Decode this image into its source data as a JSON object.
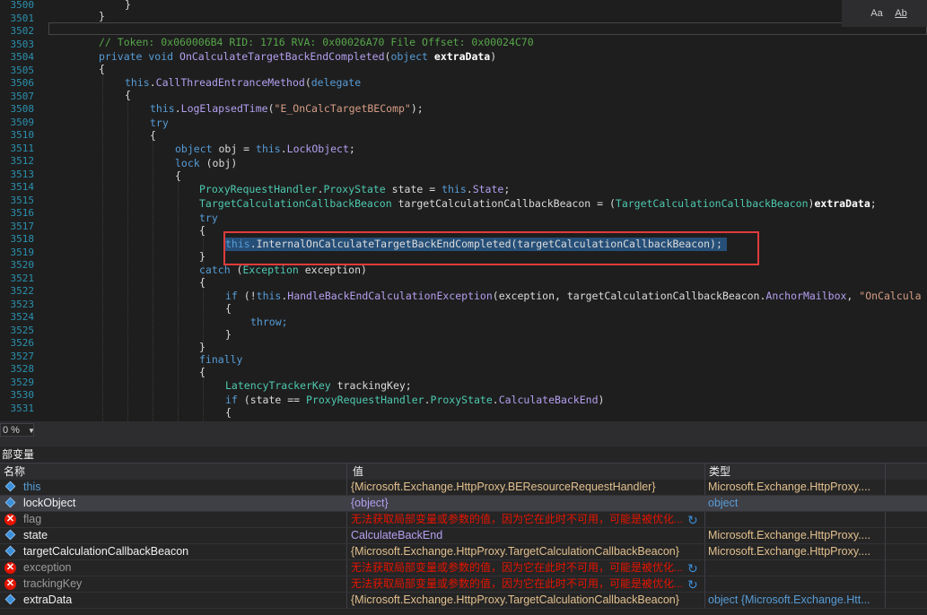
{
  "editor": {
    "line_numbers": [
      "3500",
      "3501",
      "3502",
      "3503",
      "3504",
      "3505",
      "3506",
      "3507",
      "3508",
      "3509",
      "3510",
      "3511",
      "3512",
      "3513",
      "3514",
      "3515",
      "3516",
      "3517",
      "3518",
      "3519",
      "3520",
      "3521",
      "3522",
      "3523",
      "3524",
      "3525",
      "3526",
      "3527",
      "3528",
      "3529",
      "3530",
      "3531"
    ],
    "lines": {
      "l3500": "}",
      "l3501": "}",
      "l3503": "// Token: 0x060006B4 RID: 1716 RVA: 0x00026A70 File Offset: 0x00024C70",
      "l3504_kw": "private void ",
      "l3504_name": "OnCalculateTargetBackEndCompleted",
      "l3504_p1": "(",
      "l3504_kw2": "object ",
      "l3504_arg": "extraData",
      "l3504_p2": ")",
      "l3505": "{",
      "l3506_this": "this",
      "l3506_dot": ".",
      "l3506_m": "CallThreadEntranceMethod",
      "l3506_p": "(",
      "l3506_kw": "delegate",
      "l3507": "{",
      "l3508_this": "this",
      "l3508_dot": ".",
      "l3508_m": "LogElapsedTime",
      "l3508_p": "(",
      "l3508_s": "\"E_OnCalcTargetBEComp\"",
      "l3508_e": ");",
      "l3509": "try",
      "l3510": "{",
      "l3511_kw": "object ",
      "l3511_a": "obj = ",
      "l3511_this": "this",
      "l3511_dot": ".",
      "l3511_m": "LockObject",
      "l3511_e": ";",
      "l3512_kw": "lock ",
      "l3512_a": "(obj)",
      "l3513": "{",
      "l3514_t": "ProxyRequestHandler",
      "l3514_dot": ".",
      "l3514_t2": "ProxyState",
      "l3514_a": " state = ",
      "l3514_this": "this",
      "l3514_dot2": ".",
      "l3514_m": "State",
      "l3514_e": ";",
      "l3515_t": "TargetCalculationCallbackBeacon",
      "l3515_a": " targetCalculationCallbackBeacon = (",
      "l3515_t2": "TargetCalculationCallbackBeacon",
      "l3515_p": ")",
      "l3515_b": "extraData",
      "l3515_e": ";",
      "l3516": "try",
      "l3517": "{",
      "l3518_this": "this",
      "l3518_rest": ".InternalOnCalculateTargetBackEndCompleted(targetCalculationCallbackBeacon);",
      "l3519": "}",
      "l3520_kw": "catch ",
      "l3520_p": "(",
      "l3520_t": "Exception",
      "l3520_a": " exception)",
      "l3521": "{",
      "l3522_kw": "if ",
      "l3522_a": "(!",
      "l3522_this": "this",
      "l3522_dot": ".",
      "l3522_m": "HandleBackEndCalculationException",
      "l3522_b": "(exception, targetCalculationCallbackBeacon.",
      "l3522_m2": "AnchorMailbox",
      "l3522_c": ", ",
      "l3522_s": "\"OnCalcula",
      "l3523": "{",
      "l3524": "throw;",
      "l3525": "}",
      "l3526": "}",
      "l3527": "finally",
      "l3528": "{",
      "l3529_t": "LatencyTrackerKey",
      "l3529_a": " trackingKey;",
      "l3530_kw": "if ",
      "l3530_a": "(state == ",
      "l3530_t": "ProxyRequestHandler",
      "l3530_dot": ".",
      "l3530_t2": "ProxyState",
      "l3530_dot2": ".",
      "l3530_m": "CalculateBackEnd",
      "l3530_e": ")",
      "l3531": "{"
    },
    "find_buttons": {
      "match_case": "Aa",
      "whole_word": "Ab"
    }
  },
  "statusbar": {
    "zoom": "0 %"
  },
  "locals": {
    "title": "部变量",
    "headers": {
      "name": "名称",
      "value": "值",
      "type": "类型"
    },
    "rows": [
      {
        "name": "this",
        "value": "{Microsoft.Exchange.HttpProxy.BEResourceRequestHandler}",
        "type": "Microsoft.Exchange.HttpProxy...."
      },
      {
        "name": "lockObject",
        "value": "{object}",
        "type": "object"
      },
      {
        "name": "flag",
        "value": "无法获取局部变量或参数的值，因为它在此时不可用，可能是被优化...",
        "type": ""
      },
      {
        "name": "state",
        "value": "CalculateBackEnd",
        "type": "Microsoft.Exchange.HttpProxy...."
      },
      {
        "name": "targetCalculationCallbackBeacon",
        "value": "{Microsoft.Exchange.HttpProxy.TargetCalculationCallbackBeacon}",
        "type": "Microsoft.Exchange.HttpProxy...."
      },
      {
        "name": "exception",
        "value": "无法获取局部变量或参数的值，因为它在此时不可用，可能是被优化...",
        "type": ""
      },
      {
        "name": "trackingKey",
        "value": "无法获取局部变量或参数的值，因为它在此时不可用，可能是被优化...",
        "type": ""
      },
      {
        "name": "extraData",
        "value": "{Microsoft.Exchange.HttpProxy.TargetCalculationCallbackBeacon}",
        "type": "object {Microsoft.Exchange.Htt..."
      }
    ]
  },
  "colors": {
    "editor_bg": "#1e1e1e",
    "keyword": "#569cd6",
    "type": "#4ec9b0",
    "member": "#b4a0f0",
    "string": "#d69d85",
    "comment": "#57a64a",
    "highlight_box": "#e03b3b",
    "error": "#e51400"
  },
  "icons": {
    "object": "object-icon",
    "error": "error-icon",
    "refresh": "refresh-icon"
  }
}
